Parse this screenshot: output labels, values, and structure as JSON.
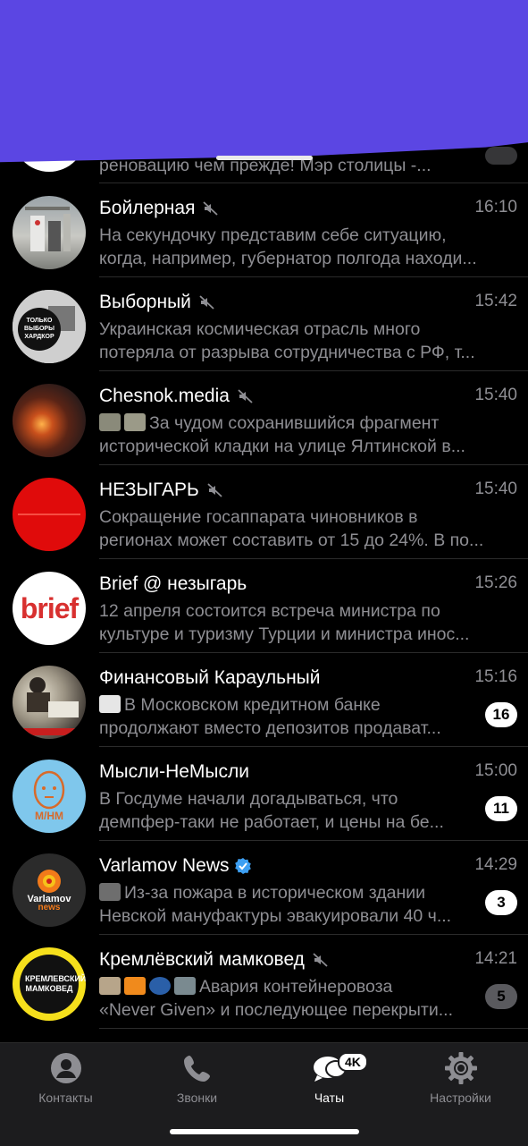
{
  "partial_row": {
    "preview": "реновацию чем прежде! Мэр столицы -..."
  },
  "chats": [
    {
      "title": "Бойлерная",
      "muted": true,
      "time": "16:10",
      "line1": "На секундочку представим себе ситуацию,",
      "line2": "когда, например, губернатор полгода находи..."
    },
    {
      "title": "Выборный",
      "muted": true,
      "time": "15:42",
      "line1": "Украинская космическая отрасль много",
      "line2": "потеряла от разрыва сотрудничества с РФ, т...",
      "avatar_text": "ТОЛЬКО ВЫБОРЫ ХАРДКОР"
    },
    {
      "title": "Chesnok.media",
      "muted": true,
      "time": "15:40",
      "line1": "За чудом сохранившийся фрагмент",
      "line2": "исторической кладки на улице Ялтинской в..."
    },
    {
      "title": "НЕЗЫГАРЬ",
      "muted": true,
      "time": "15:40",
      "line1": "Сокращение госаппарата чиновников в",
      "line2": "регионах может составить от 15 до 24%. В по..."
    },
    {
      "title": "Brief @ незыгарь",
      "muted": false,
      "time": "15:26",
      "line1": "12 апреля состоится встреча министра по",
      "line2": "культуре и туризму Турции и министра инос...",
      "avatar_text": "brief"
    },
    {
      "title": "Финансовый Караульный",
      "muted": false,
      "time": "15:16",
      "line1": "В Московском кредитном банке",
      "line2": "продолжают вместо депозитов продават...",
      "badge": "16"
    },
    {
      "title": "Мысли-НеМысли",
      "muted": false,
      "time": "15:00",
      "line1": "В Госдуме начали догадываться, что",
      "line2": "демпфер-таки не работает, и цены на бе...",
      "badge": "11",
      "avatar_text": "М/НМ"
    },
    {
      "title": "Varlamov News",
      "muted": false,
      "verified": true,
      "time": "14:29",
      "line1": "Из-за пожара в историческом здании",
      "line2": "Невской мануфактуры эвакуировали 40 ч...",
      "badge": "3",
      "avatar_text": "Varlamov",
      "avatar_sub": "news"
    },
    {
      "title": "Кремлёвский мамковед",
      "muted": true,
      "time": "14:21",
      "line1": "Авария контейнеровоза",
      "line2": "«Never Given» и последующее перекрыти...",
      "badge": "5",
      "avatar_text": "КРЕМЛЕВСКИЙ МАМКОВЕД"
    }
  ],
  "tabbar": {
    "contacts": "Контакты",
    "calls": "Звонки",
    "chats": "Чаты",
    "chats_badge": "4K",
    "settings": "Настройки"
  },
  "colors": {
    "accent": "#ffffff",
    "inactive": "#8e8e93",
    "verified": "#3d9ff2",
    "redaction": "#5b46e3"
  }
}
